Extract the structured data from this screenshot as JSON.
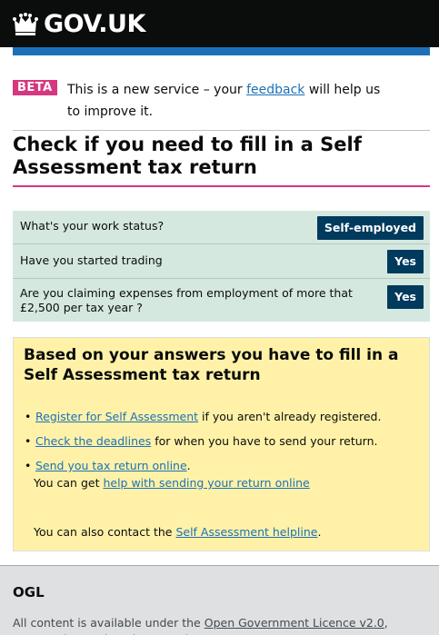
{
  "header": {
    "logo_text": "GOV.UK",
    "brand_color": "#0b0c0c",
    "accent_color": "#1d70b8"
  },
  "beta": {
    "tag": "BETA",
    "text_before": "This is a new service – your ",
    "link": "feedback",
    "text_after": " will help us to improve it."
  },
  "page_title": "Check if you need to fill in a Self Assessment tax return",
  "answers": [
    {
      "question": "What's your work status?",
      "answer": "Self-employed"
    },
    {
      "question": "Have you started trading",
      "answer": "Yes"
    },
    {
      "question": "Are you claiming expenses from employment of more that £2,500 per tax year ?",
      "answer": "Yes"
    }
  ],
  "result": {
    "heading": "Based on your answers you have to fill in a Self Assessment tax return",
    "items": [
      {
        "link": "Register for Self Assessment",
        "text": " if you aren't already registered."
      },
      {
        "link": "Check the deadlines",
        "text": " for when you have to send your return."
      },
      {
        "link": "Send you tax return online",
        "text": "."
      }
    ],
    "help_before": "You can get ",
    "help_link": "help with sending your return online",
    "contact_before": "You can also contact the ",
    "contact_link": "Self Assessment helpline",
    "contact_after": "."
  },
  "footer": {
    "logo": "OGL",
    "text_before": "All content is available under the ",
    "link": "Open Government Licence v2.0",
    "text_after": ", except where otherwise stated"
  }
}
